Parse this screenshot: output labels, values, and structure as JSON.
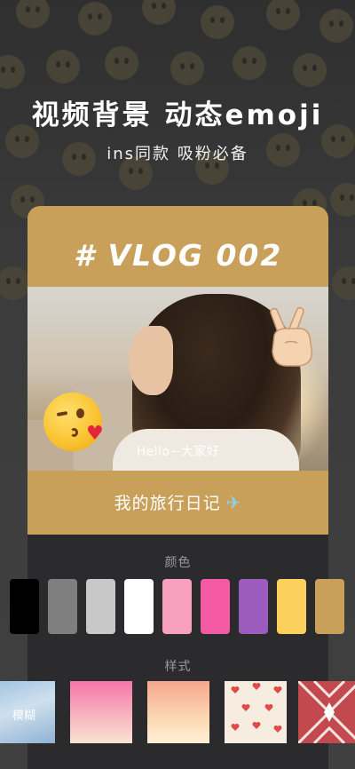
{
  "headline": "视频背景 动态emoji",
  "subline": "ins同款 吸粉必备",
  "card": {
    "vlog_title": "# VLOG 002",
    "photo_caption": "Hello~大家好",
    "diary_title": "我的旅行日记",
    "plane_icon": "✈"
  },
  "colors_section": {
    "label": "颜色",
    "swatches": [
      "#000000",
      "#7f7f7f",
      "#c8c8c8",
      "#ffffff",
      "#f7a0be",
      "#f45aa3",
      "#9b5cbd",
      "#fcd05d",
      "#c9a05a"
    ]
  },
  "styles_section": {
    "label": "样式",
    "items": [
      {
        "name": "blur",
        "label": "模糊"
      },
      {
        "name": "pink-gradient"
      },
      {
        "name": "peach-gradient"
      },
      {
        "name": "hearts-pattern"
      },
      {
        "name": "red-diamond-pattern"
      }
    ]
  },
  "stickers": [
    "kissing-face-emoji",
    "victory-hand-emoji"
  ]
}
